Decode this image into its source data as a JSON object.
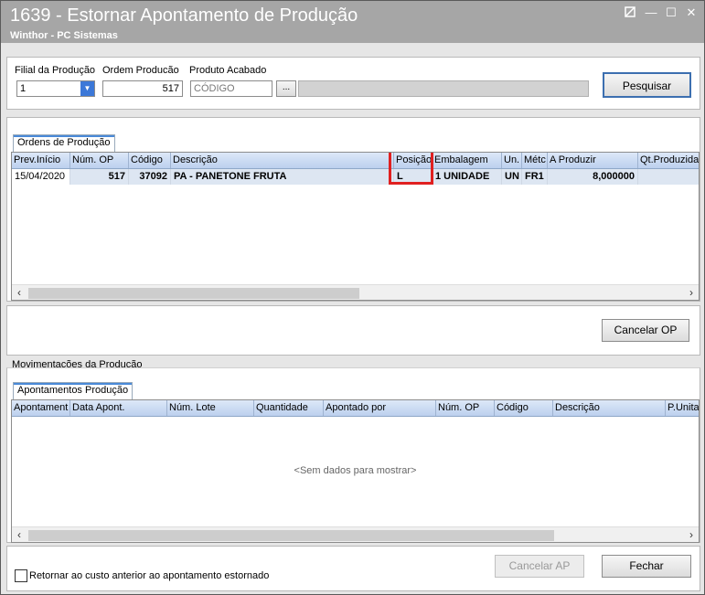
{
  "window": {
    "title": "1639 - Estornar Apontamento de Produção",
    "subtitle": "Winthor - PC Sistemas",
    "buttons": {
      "restore_icon": "restore-icon",
      "minimize": "—",
      "maximize": "☐",
      "close": "✕"
    }
  },
  "filters": {
    "filial_label": "Filial da Produção",
    "filial_value": "1",
    "ordem_label": "Ordem Producão",
    "ordem_value": "517",
    "produto_label": "Produto Acabado",
    "produto_placeholder": "CÓDIGO",
    "ellipsis": "...",
    "search_button": "Pesquisar"
  },
  "orders": {
    "tab": "Ordens de Produção",
    "columns": [
      "Prev.Início",
      "Núm. OP",
      "Código",
      "Descrição",
      "Posição",
      "Embalagem",
      "Un.",
      "Métc",
      "A Produzir",
      "Qt.Produzida"
    ],
    "rows": [
      [
        "15/04/2020",
        "517",
        "37092",
        "PA - PANETONE FRUTA",
        "L",
        "1 UNIDADE",
        "UN",
        "FR1",
        "8,000000",
        ""
      ]
    ],
    "highlight_color": "#e02020"
  },
  "cancel_op_button": "Cancelar OP",
  "movements": {
    "section_label": "Movimentações da Produção",
    "tab": "Apontamentos Produção",
    "columns": [
      "Apontament",
      "Data Apont.",
      "Núm. Lote",
      "Quantidade",
      "Apontado por",
      "Núm. OP",
      "Código",
      "Descrição",
      "P.Unita"
    ],
    "empty_text": "<Sem dados para mostrar>"
  },
  "footer": {
    "checkbox_label": "Retornar ao custo anterior ao apontamento estornado",
    "checkbox_checked": false,
    "cancel_ap_button": "Cancelar AP",
    "close_button": "Fechar"
  }
}
